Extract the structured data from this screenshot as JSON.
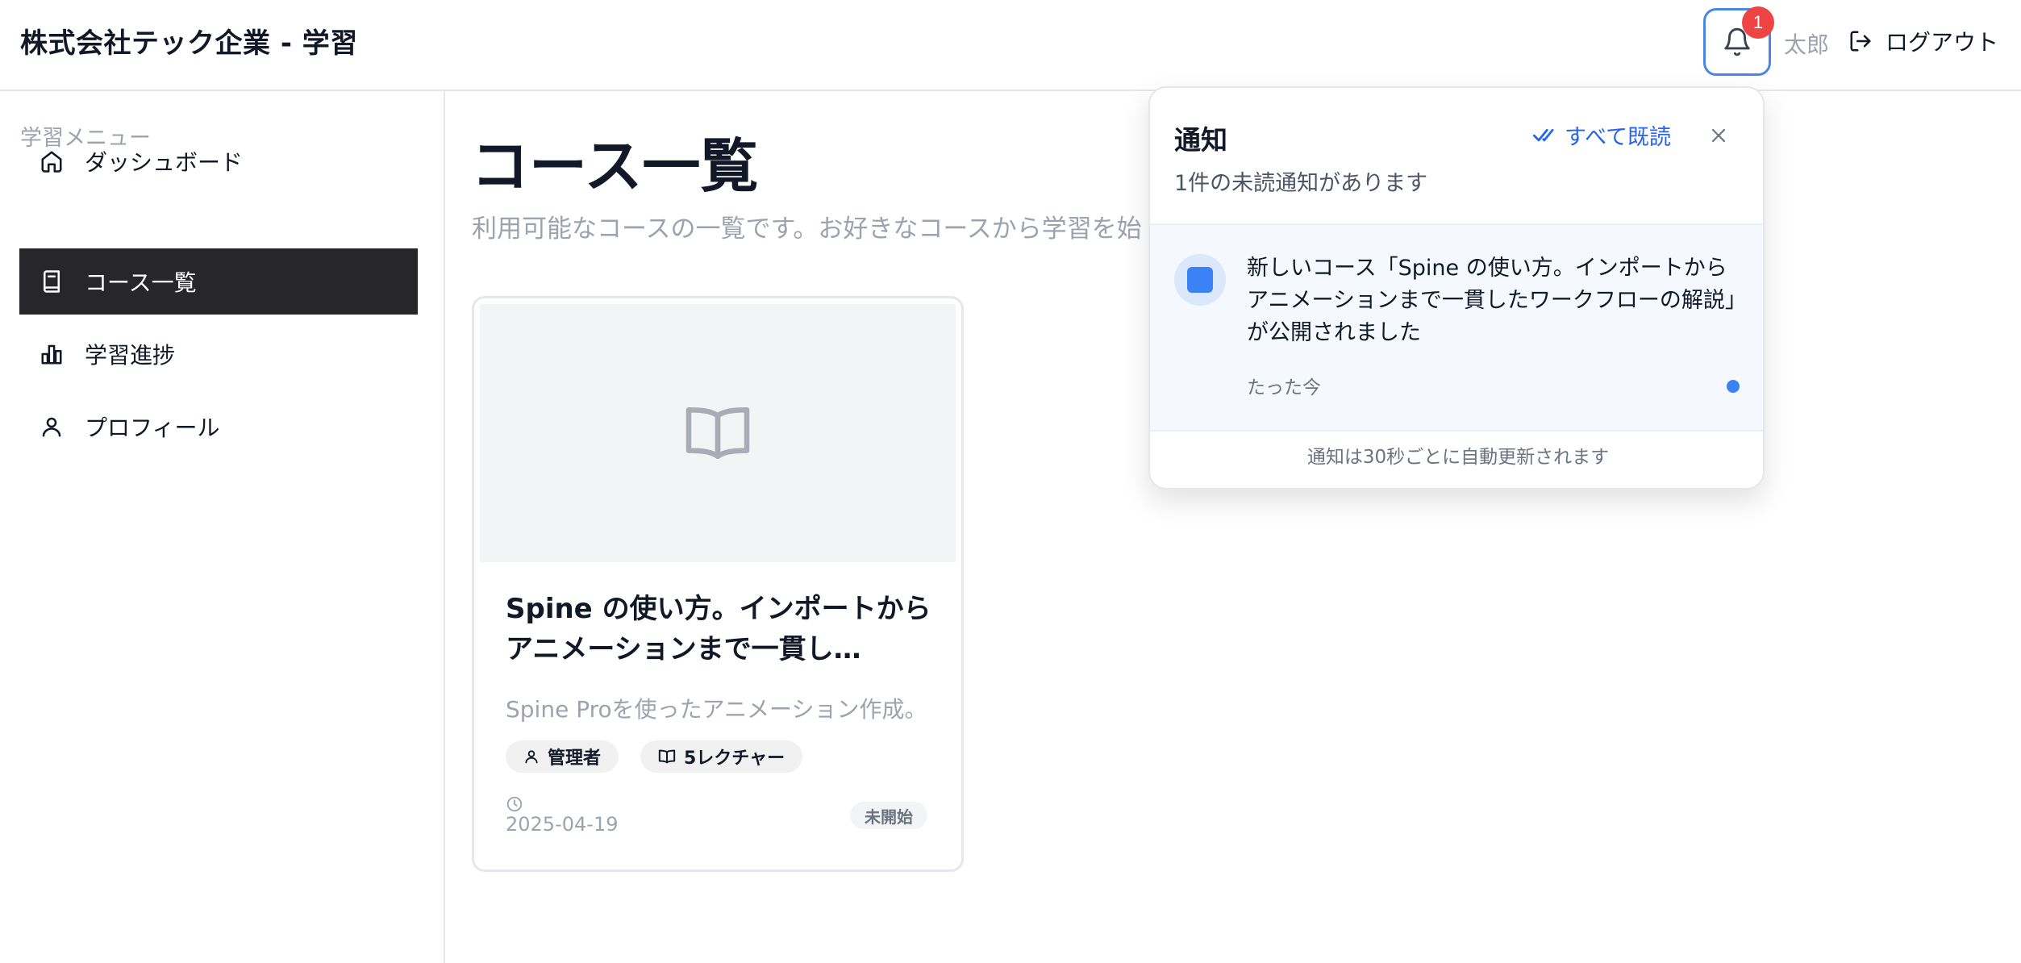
{
  "header": {
    "app_title": "株式会社テック企業 - 学習",
    "notification_count": "1",
    "user_name": "太郎",
    "logout_label": "ログアウト"
  },
  "sidebar": {
    "heading": "学習メニュー",
    "items": [
      {
        "label": "ダッシュボード",
        "icon": "home-icon",
        "active": false
      },
      {
        "label": "コース一覧",
        "icon": "book-icon",
        "active": true
      },
      {
        "label": "学習進捗",
        "icon": "bar-chart-icon",
        "active": false
      },
      {
        "label": "プロフィール",
        "icon": "user-icon",
        "active": false
      }
    ]
  },
  "main": {
    "title": "コース一覧",
    "subtitle": "利用可能なコースの一覧です。お好きなコースから学習を始"
  },
  "course": {
    "title": "Spine の使い方。インポートからアニメーションまで一貫し…",
    "description": "Spine Proを使ったアニメーション作成。",
    "author": "管理者",
    "lectures": "5レクチャー",
    "date": "2025-04-19",
    "status": "未開始"
  },
  "notifications": {
    "title": "通知",
    "mark_all_read": "すべて既読",
    "unread_summary": "1件の未読通知があります",
    "items": [
      {
        "message": "新しいコース「Spine の使い方。インポートからアニメーションまで一貫したワークフローの解説」が公開されました",
        "time": "たった今",
        "unread": true
      }
    ],
    "footer": "通知は30秒ごとに自動更新されます"
  },
  "colors": {
    "accent": "#2563eb",
    "active_nav_bg": "#27272a",
    "badge": "#ef4444",
    "unread_dot": "#3b82f6"
  }
}
